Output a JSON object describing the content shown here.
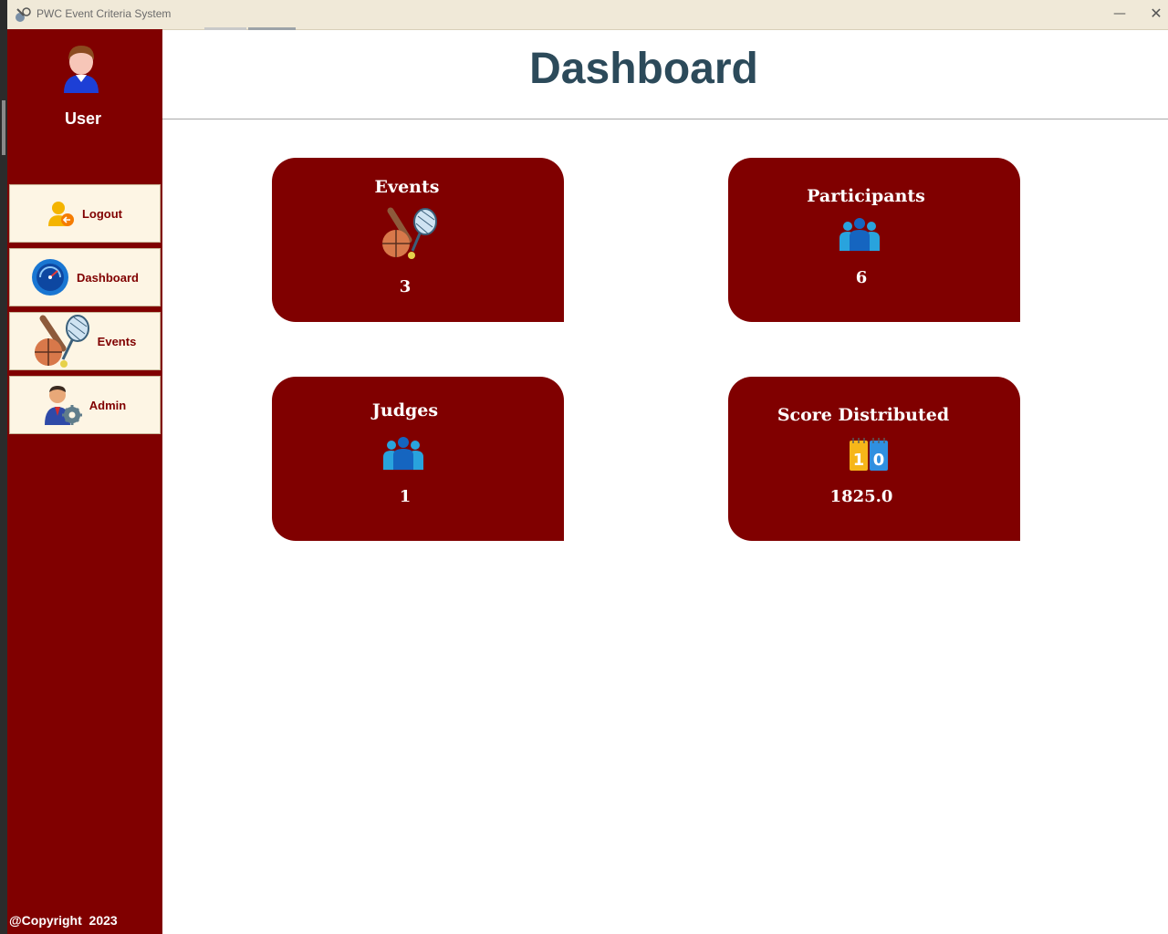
{
  "window": {
    "title": "PWC Event Criteria System",
    "minimize_glyph": "—",
    "close_glyph": "✕"
  },
  "sidebar": {
    "username": "User",
    "items": [
      {
        "label": "Logout",
        "icon": "logout-icon"
      },
      {
        "label": "Dashboard",
        "icon": "dashboard-gauge-icon"
      },
      {
        "label": "Events",
        "icon": "sports-icon"
      },
      {
        "label": "Admin",
        "icon": "admin-gear-icon"
      }
    ],
    "copyright": "@Copyright  2023"
  },
  "main": {
    "title": "Dashboard",
    "cards": [
      {
        "title": "Events",
        "value": "3",
        "icon": "sports-icon"
      },
      {
        "title": "Participants",
        "value": "6",
        "icon": "group-icon"
      },
      {
        "title": "Judges",
        "value": "1",
        "icon": "group-icon"
      },
      {
        "title": "Score Distributed",
        "value": "1825.0",
        "icon": "scoreboard-icon"
      }
    ]
  },
  "colors": {
    "sidebar_bg": "#800000",
    "nav_button_bg": "#fdf5e4",
    "card_bg": "#800000",
    "title_color": "#2c4a5a",
    "titlebar_bg": "#f0e9d8"
  }
}
